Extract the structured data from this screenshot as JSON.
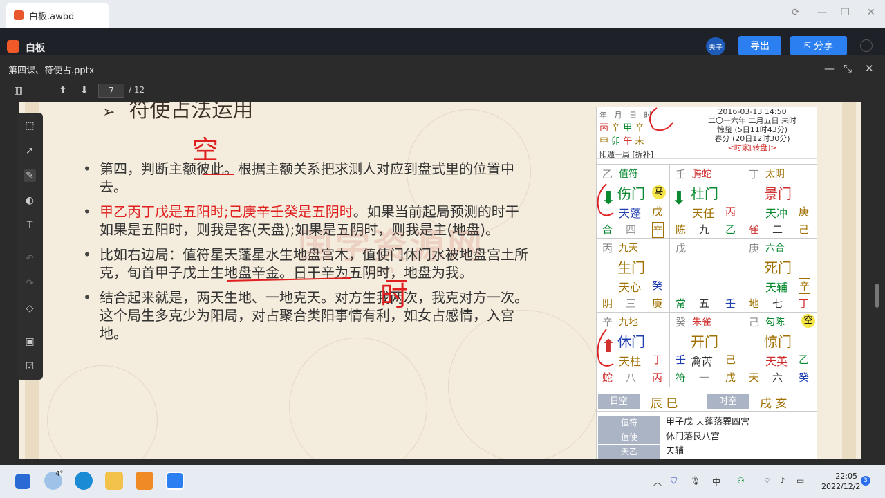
{
  "browser": {
    "tab_title": "白板.awbd"
  },
  "app": {
    "title": "白板",
    "avatar_label": "夫子",
    "export_label": "导出",
    "share_label": "分享"
  },
  "document": {
    "filename": "第四课、符使占.pptx",
    "page_current": "7",
    "page_total": "/ 12"
  },
  "slide": {
    "title": "符使占法运用",
    "bullets": [
      {
        "text": "第四，判断主额彼此。根据主额关系把求测人对应到盘式里的位置中去。"
      },
      {
        "red": "甲乙丙丁戊是五阳时;己庚辛壬癸是五阴时",
        "text": "。如果当前起局预测的时干如果是五阳时，则我是客(天盘);如果是五阴时，则我是主(地盘)。"
      },
      {
        "text": "比如右边局：值符星天蓬星水生地盘宫木，值使门休门水被地盘宫土所克，旬首甲子戊土生地盘辛金。日干辛为五阴时，地盘为我。"
      },
      {
        "text": "结合起来就是，两天生地、一地克天。对方生我两次，我克对方一次。这个局生多克少为阳局，对占聚合类阳事情有利，如女占感情，入宫地。"
      }
    ],
    "watermark": "国学资源网",
    "watermark_url": ".com",
    "annotations": {
      "kong": "空",
      "shi": "时"
    }
  },
  "chart_panel": {
    "pillar_headers": [
      "年",
      "月",
      "日",
      "时"
    ],
    "stems": [
      "丙",
      "辛",
      "甲",
      "辛"
    ],
    "branches": [
      "申",
      "卯",
      "午",
      "未"
    ],
    "ju": "阳遁一局 [拆补]",
    "datetime": "2016-03-13 14:50",
    "lunar": "二〇一六年 二月五日 未时",
    "jieqi1": "惊蛰 (5日11时43分)",
    "jieqi2": "春分 (20日12时30分)",
    "mode": "<时家[转盘]>",
    "cells": [
      {
        "tl": "乙",
        "god": "值符",
        "door": "伤门",
        "star": "天蓬",
        "sr": "戊",
        "bl": "合",
        "bm": "四",
        "br": "辛",
        "badge": "马"
      },
      {
        "tl": "壬",
        "god": "腾蛇",
        "door": "杜门",
        "star": "天任",
        "sr": "丙",
        "bl": "陈",
        "bm": "九",
        "br": "乙"
      },
      {
        "tl": "丁",
        "god": "太阴",
        "door": "景门",
        "star": "天冲",
        "sr": "庚",
        "bl": "雀",
        "bm": "二",
        "br": "己"
      },
      {
        "tl": "丙",
        "god": "九天",
        "door": "生门",
        "star": "天心",
        "sr": "癸",
        "bl": "阴",
        "bm": "三",
        "br": "庚"
      },
      {
        "tl": "戊",
        "god": "",
        "door": "",
        "star": "",
        "sr": "",
        "bl": "常",
        "bm": "五",
        "br": "壬"
      },
      {
        "tl": "庚",
        "god": "六合",
        "door": "死门",
        "star": "天辅",
        "sr": "辛",
        "bl": "地",
        "bm": "七",
        "br": "丁"
      },
      {
        "tl": "辛",
        "god": "九地",
        "door": "休门",
        "star": "天柱",
        "sr": "丁",
        "bl": "蛇",
        "bm": "八",
        "br": "丙"
      },
      {
        "tl": "癸",
        "god": "朱雀",
        "door": "开门",
        "star": "禽芮",
        "sr": "己",
        "bl": "壬",
        "bm": "符",
        "br": "戊",
        "bm2": "一"
      },
      {
        "tl": "己",
        "god": "勾陈",
        "door": "惊门",
        "star": "天英",
        "sr": "乙",
        "bl": "天",
        "bm": "六",
        "br": "癸",
        "badge": "空"
      }
    ],
    "ri_kong_label": "日空",
    "ri_kong": "辰 巳",
    "shi_kong_label": "时空",
    "shi_kong": "戌 亥",
    "zhifu_label": "值符",
    "zhifu_val": "甲子戊 天蓬落巽四宫",
    "zhishi_label": "值使",
    "zhishi_val": "休门落艮八宫",
    "tianyi_label": "天乙",
    "tianyi_val": "天辅"
  },
  "taskbar": {
    "weather": "4°",
    "time": "22:05",
    "date": "2022/12/2",
    "notifications": "3"
  }
}
